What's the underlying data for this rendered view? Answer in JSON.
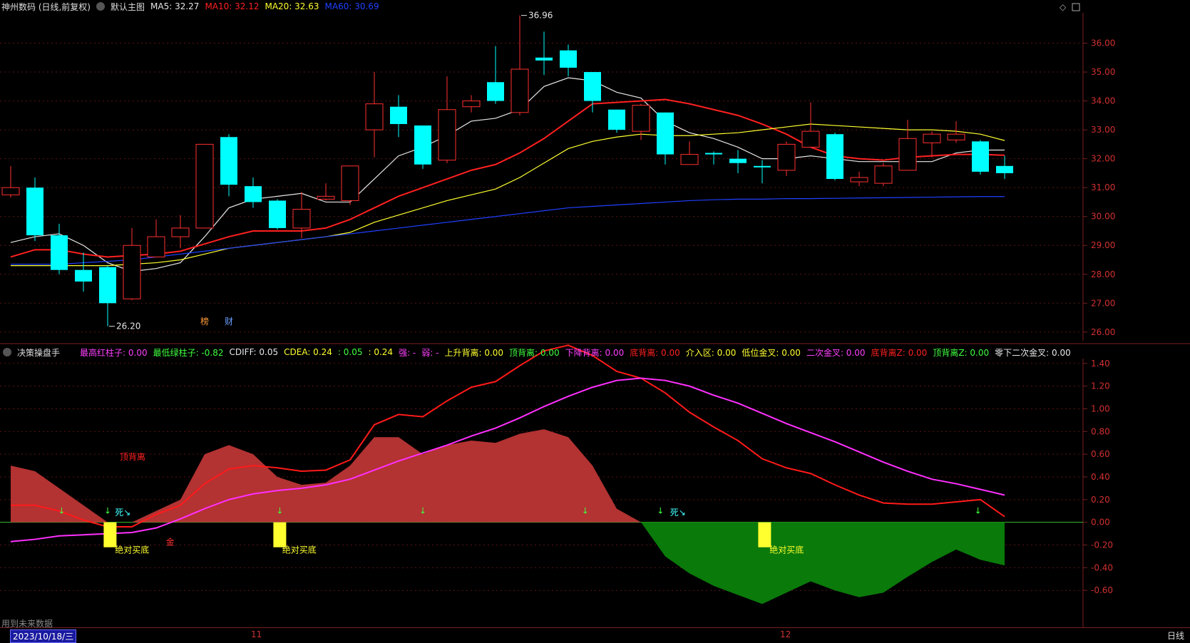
{
  "header": {
    "stock_name": "神州数码 (日线,前复权)",
    "template_label": "默认主图",
    "ma5": {
      "label": "MA5: 32.27",
      "color": "#e6e6e6"
    },
    "ma10": {
      "label": "MA10: 32.12",
      "color": "#ff2020"
    },
    "ma20": {
      "label": "MA20: 32.63",
      "color": "#ffff30"
    },
    "ma60": {
      "label": "MA60: 30.69",
      "color": "#2040ff"
    }
  },
  "indicator": {
    "name": "决策操盘手",
    "items": [
      {
        "label": "最高红柱子: 0.00",
        "color": "#ff40ff"
      },
      {
        "label": "最低绿柱子: -0.82",
        "color": "#40ff40"
      },
      {
        "label": "CDIFF: 0.05",
        "color": "#e6e6e6"
      },
      {
        "label": "CDEA: 0.24",
        "color": "#ffff30"
      },
      {
        "label": ": 0.05",
        "color": "#40ff40"
      },
      {
        "label": ": 0.24",
        "color": "#ffff30"
      },
      {
        "label": "强: -",
        "color": "#ff40ff"
      },
      {
        "label": "弱: -",
        "color": "#ff40ff"
      },
      {
        "label": "上升背离: 0.00",
        "color": "#ffff30"
      },
      {
        "label": "顶背离: 0.00",
        "color": "#40ff40"
      },
      {
        "label": "下降背离: 0.00",
        "color": "#ff40ff"
      },
      {
        "label": "底背离: 0.00",
        "color": "#ff2020"
      },
      {
        "label": "介入区: 0.00",
        "color": "#ffff30"
      },
      {
        "label": "低位金叉: 0.00",
        "color": "#ffff30"
      },
      {
        "label": "二次金叉: 0.00",
        "color": "#ff40ff"
      },
      {
        "label": "底背离Z: 0.00",
        "color": "#ff2020"
      },
      {
        "label": "顶背离Z: 0.00",
        "color": "#40ff40"
      },
      {
        "label": "零下二次金叉: 0.00",
        "color": "#e6e6e6"
      }
    ]
  },
  "footer": {
    "date": "2023/10/18/三",
    "months": [
      "11",
      "12"
    ],
    "period": "日线",
    "note": "用到未来数据"
  },
  "chart_data": [
    {
      "type": "candlestick",
      "ylim": [
        25.7,
        37.0
      ],
      "yticks": [
        26.0,
        27.0,
        28.0,
        29.0,
        30.0,
        31.0,
        32.0,
        33.0,
        34.0,
        35.0,
        36.0
      ],
      "ytick_labels": [
        "26.00",
        "27.00",
        "28.00",
        "29.00",
        "30.00",
        "31.00",
        "32.00",
        "33.00",
        "34.00",
        "35.00",
        "36.00"
      ],
      "annotations": [
        {
          "text": "36.96",
          "x": 21,
          "y": 36.96
        },
        {
          "text": "26.20",
          "x": 4,
          "y": 26.2
        }
      ],
      "badges": [
        {
          "text": "榜",
          "x": 8,
          "color": "#ff9a3a"
        },
        {
          "text": "财",
          "x": 9,
          "color": "#6aa0ff"
        }
      ],
      "up_color": "#ff3030",
      "down_color": "#00ffff",
      "candles": [
        [
          30.75,
          31.0,
          31.75,
          30.65
        ],
        [
          31.0,
          29.35,
          31.35,
          29.15
        ],
        [
          29.35,
          28.15,
          29.75,
          28.0
        ],
        [
          28.15,
          27.75,
          28.75,
          27.4
        ],
        [
          28.25,
          27.0,
          28.3,
          26.2
        ],
        [
          27.15,
          29.0,
          29.6,
          27.1
        ],
        [
          28.6,
          29.3,
          29.9,
          28.6
        ],
        [
          29.3,
          29.6,
          30.05,
          28.9
        ],
        [
          29.6,
          32.5,
          32.5,
          29.6
        ],
        [
          32.75,
          31.1,
          32.85,
          30.7
        ],
        [
          31.05,
          30.5,
          31.35,
          30.3
        ],
        [
          30.55,
          29.6,
          30.6,
          29.55
        ],
        [
          29.6,
          30.25,
          30.85,
          29.25
        ],
        [
          30.6,
          30.7,
          31.15,
          30.55
        ],
        [
          30.55,
          31.75,
          31.75,
          30.4
        ],
        [
          33.0,
          33.9,
          35.0,
          32.05
        ],
        [
          33.8,
          33.2,
          34.2,
          32.75
        ],
        [
          33.15,
          31.8,
          33.15,
          31.65
        ],
        [
          31.95,
          33.7,
          34.85,
          31.85
        ],
        [
          33.8,
          34.0,
          34.2,
          33.6
        ],
        [
          34.65,
          34.0,
          35.9,
          33.9
        ],
        [
          33.6,
          35.1,
          36.96,
          33.5
        ],
        [
          35.5,
          35.4,
          36.4,
          34.9
        ],
        [
          35.75,
          35.15,
          35.95,
          34.85
        ],
        [
          35.0,
          34.0,
          35.0,
          33.6
        ],
        [
          33.7,
          33.0,
          33.7,
          32.9
        ],
        [
          32.95,
          33.85,
          33.9,
          32.65
        ],
        [
          33.6,
          32.15,
          33.6,
          31.8
        ],
        [
          31.8,
          32.15,
          32.6,
          31.8
        ],
        [
          32.2,
          32.15,
          32.25,
          31.8
        ],
        [
          32.0,
          31.85,
          32.3,
          31.5
        ],
        [
          31.75,
          31.7,
          31.95,
          31.15
        ],
        [
          31.6,
          32.5,
          32.6,
          31.4
        ],
        [
          32.4,
          32.95,
          33.95,
          32.4
        ],
        [
          32.85,
          31.3,
          32.9,
          31.25
        ],
        [
          31.2,
          31.35,
          31.55,
          31.05
        ],
        [
          31.15,
          31.75,
          31.85,
          31.05
        ],
        [
          31.6,
          32.7,
          33.35,
          31.6
        ],
        [
          32.55,
          32.85,
          32.95,
          32.05
        ],
        [
          32.65,
          32.85,
          33.3,
          32.55
        ],
        [
          32.6,
          31.55,
          32.65,
          31.45
        ],
        [
          31.75,
          31.5,
          32.1,
          31.3
        ]
      ],
      "series": [
        {
          "name": "MA5",
          "color": "#e6e6e6",
          "values": [
            29.1,
            29.3,
            29.4,
            29.0,
            28.4,
            28.1,
            28.2,
            28.4,
            29.3,
            30.3,
            30.6,
            30.7,
            30.8,
            30.5,
            30.5,
            31.3,
            32.1,
            32.4,
            32.8,
            33.3,
            33.4,
            33.7,
            34.5,
            34.8,
            34.7,
            34.3,
            34.1,
            33.3,
            32.9,
            32.7,
            32.4,
            32.0,
            32.0,
            32.1,
            32.0,
            31.9,
            31.9,
            31.9,
            31.9,
            32.2,
            32.3,
            32.3
          ]
        },
        {
          "name": "MA10",
          "color": "#ff2020",
          "values": [
            28.6,
            28.85,
            28.85,
            28.7,
            28.6,
            28.65,
            28.7,
            28.8,
            29.05,
            29.3,
            29.5,
            29.5,
            29.5,
            29.6,
            29.9,
            30.3,
            30.7,
            31.0,
            31.3,
            31.6,
            31.8,
            32.2,
            32.7,
            33.3,
            33.9,
            33.95,
            34.0,
            34.05,
            33.9,
            33.7,
            33.5,
            33.2,
            32.85,
            32.4,
            32.1,
            32.0,
            31.95,
            32.05,
            32.1,
            32.15,
            32.15,
            32.12
          ]
        },
        {
          "name": "MA20",
          "color": "#ffff30",
          "values": [
            28.3,
            28.3,
            28.3,
            28.3,
            28.3,
            28.35,
            28.4,
            28.5,
            28.7,
            28.9,
            29.0,
            29.1,
            29.2,
            29.3,
            29.45,
            29.8,
            30.05,
            30.3,
            30.55,
            30.75,
            30.95,
            31.35,
            31.85,
            32.35,
            32.6,
            32.75,
            32.85,
            32.8,
            32.8,
            32.85,
            32.9,
            33.0,
            33.1,
            33.2,
            33.15,
            33.1,
            33.05,
            33.0,
            33.0,
            32.95,
            32.85,
            32.63
          ]
        },
        {
          "name": "MA60",
          "color": "#2040ff",
          "values": [
            28.35,
            28.35,
            28.35,
            28.4,
            28.45,
            28.5,
            28.6,
            28.7,
            28.8,
            28.9,
            29.0,
            29.1,
            29.2,
            29.3,
            29.4,
            29.5,
            29.6,
            29.7,
            29.8,
            29.9,
            30.0,
            30.1,
            30.2,
            30.3,
            30.35,
            30.4,
            30.45,
            30.5,
            30.55,
            30.58,
            30.6,
            30.6,
            30.62,
            30.62,
            30.63,
            30.64,
            30.65,
            30.66,
            30.67,
            30.68,
            30.69,
            30.69
          ]
        }
      ]
    },
    {
      "type": "area",
      "ylim": [
        -0.85,
        1.65
      ],
      "yticks": [
        -0.6,
        -0.4,
        -0.2,
        0.0,
        0.2,
        0.4,
        0.6,
        0.8,
        1.0,
        1.2,
        1.4,
        1.6
      ],
      "ytick_labels": [
        "-0.60",
        "-0.40",
        "-0.20",
        "0.00",
        "0.20",
        "0.40",
        "0.60",
        "0.80",
        "1.00",
        "1.20",
        "1.40",
        "1.60"
      ],
      "histogram": [
        0.5,
        0.45,
        0.3,
        0.15,
        0.0,
        0.0,
        0.1,
        0.2,
        0.6,
        0.68,
        0.6,
        0.4,
        0.33,
        0.35,
        0.5,
        0.75,
        0.75,
        0.6,
        0.68,
        0.72,
        0.7,
        0.78,
        0.82,
        0.75,
        0.5,
        0.12,
        0.0,
        -0.3,
        -0.45,
        -0.56,
        -0.64,
        -0.72,
        -0.62,
        -0.52,
        -0.6,
        -0.66,
        -0.62,
        -0.48,
        -0.35,
        -0.24,
        -0.33,
        -0.38
      ],
      "pos_color": "#b33232",
      "neg_color": "#0a7a0a",
      "series": [
        {
          "name": "CDIFF",
          "color": "#ff1a1a",
          "values": [
            0.15,
            0.15,
            0.1,
            0.02,
            -0.04,
            -0.04,
            0.07,
            0.15,
            0.34,
            0.47,
            0.5,
            0.48,
            0.45,
            0.46,
            0.55,
            0.86,
            0.95,
            0.93,
            1.07,
            1.19,
            1.24,
            1.38,
            1.51,
            1.56,
            1.47,
            1.33,
            1.27,
            1.14,
            0.97,
            0.84,
            0.72,
            0.56,
            0.48,
            0.43,
            0.33,
            0.24,
            0.17,
            0.16,
            0.16,
            0.18,
            0.2,
            0.05
          ]
        },
        {
          "name": "CDEA",
          "color": "#ff30ff",
          "values": [
            -0.17,
            -0.15,
            -0.12,
            -0.11,
            -0.1,
            -0.09,
            -0.05,
            0.03,
            0.12,
            0.2,
            0.25,
            0.28,
            0.3,
            0.33,
            0.38,
            0.46,
            0.54,
            0.61,
            0.68,
            0.76,
            0.83,
            0.92,
            1.02,
            1.11,
            1.19,
            1.25,
            1.27,
            1.25,
            1.2,
            1.12,
            1.05,
            0.96,
            0.87,
            0.79,
            0.71,
            0.62,
            0.53,
            0.45,
            0.38,
            0.34,
            0.29,
            0.24
          ]
        }
      ],
      "labels": [
        {
          "text": "顶背离",
          "x": 4.5,
          "y": 0.55,
          "color": "#ff2020"
        },
        {
          "text": "死↘",
          "x": 4.3,
          "y": 0.06,
          "color": "#40ffff"
        },
        {
          "text": "死↘",
          "x": 27.2,
          "y": 0.06,
          "color": "#40ffff"
        },
        {
          "text": "绝对买底",
          "x": 4.3,
          "y": -0.27,
          "color": "#ffff30"
        },
        {
          "text": "绝对买底",
          "x": 11.2,
          "y": -0.27,
          "color": "#ffff30"
        },
        {
          "text": "绝对买底",
          "x": 31.3,
          "y": -0.27,
          "color": "#ffff30"
        },
        {
          "text": "金",
          "x": 6.4,
          "y": -0.2,
          "color": "#ff3030"
        }
      ],
      "buy_bars": [
        {
          "x": 4.1,
          "y": -0.22
        },
        {
          "x": 11.1,
          "y": -0.22
        },
        {
          "x": 31.1,
          "y": -0.22
        }
      ],
      "arrows": [
        2.1,
        4.0,
        11.1,
        17.0,
        23.7,
        26.8,
        39.9
      ]
    }
  ]
}
